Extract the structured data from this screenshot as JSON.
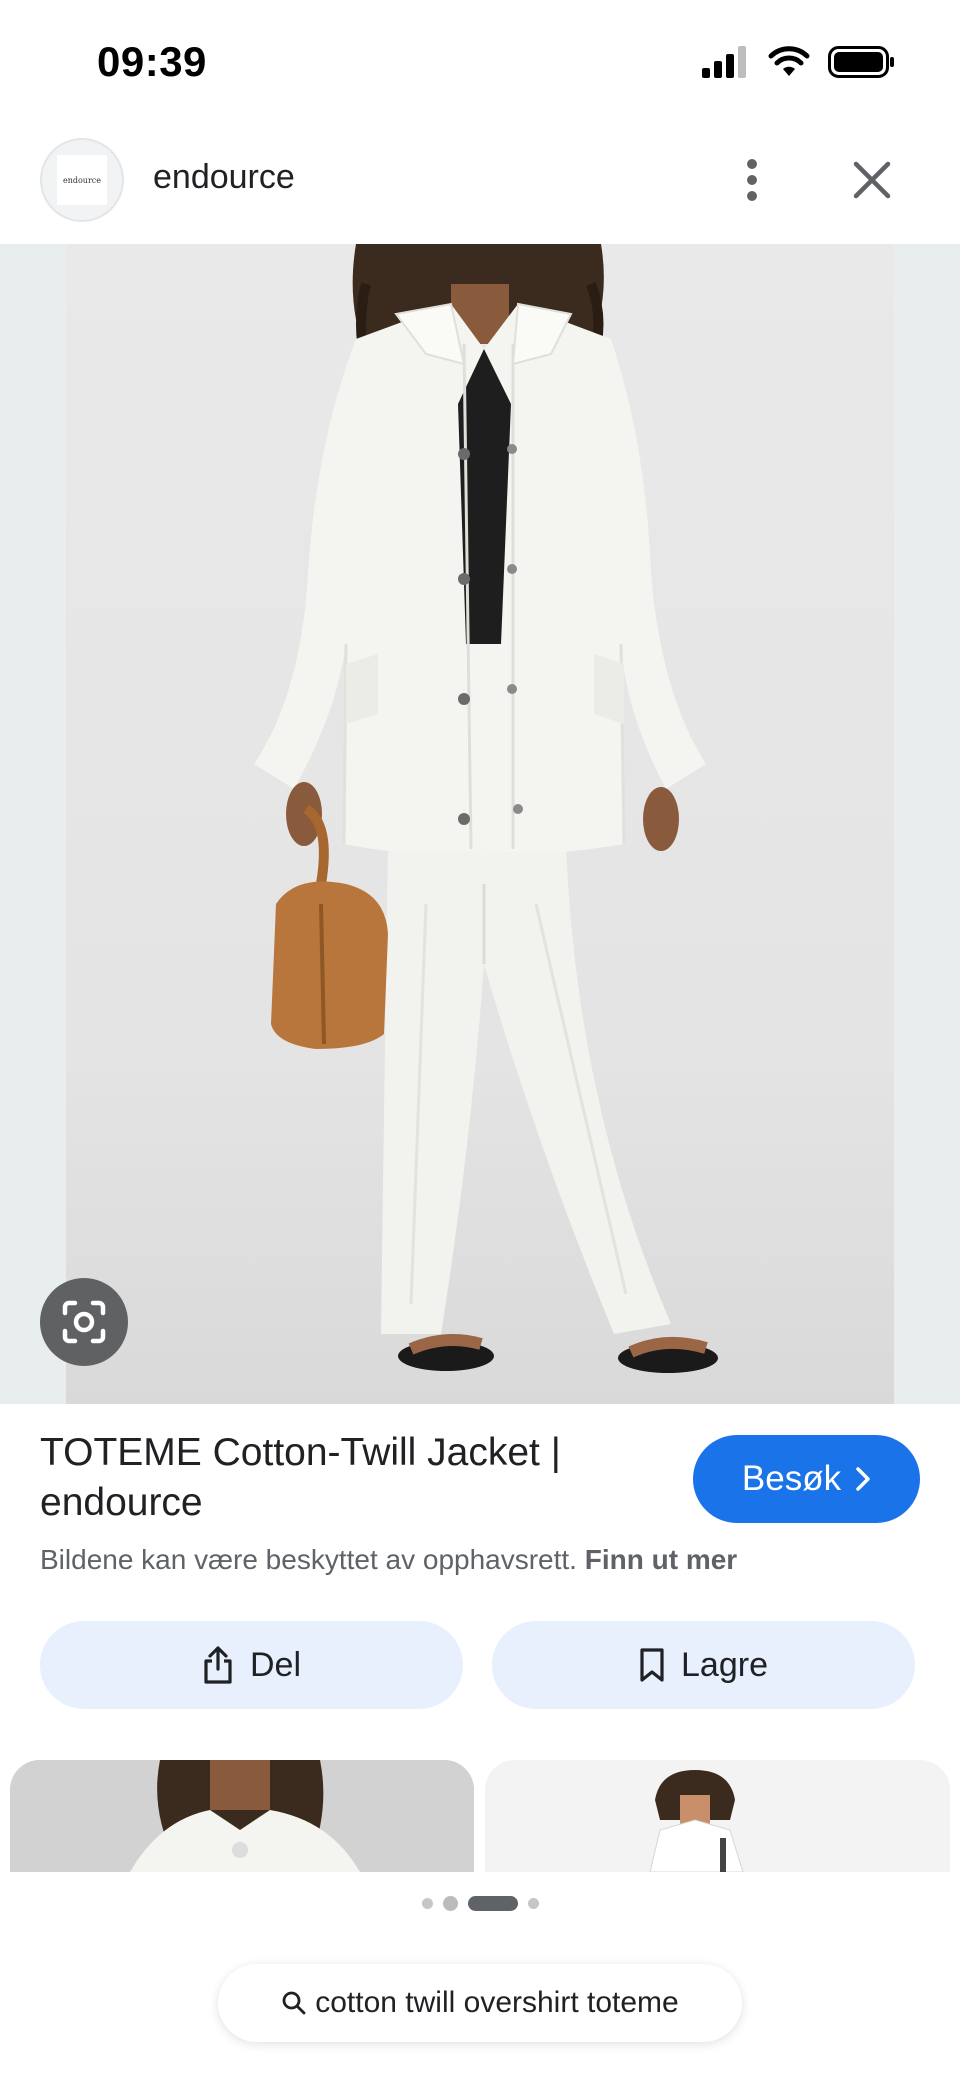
{
  "status_bar": {
    "time": "09:39",
    "icons": [
      "cellular-signal-icon",
      "wifi-icon",
      "battery-icon"
    ]
  },
  "header": {
    "site_logo_text": "endource",
    "site_name": "endource",
    "icons": [
      "more-vertical-icon",
      "close-icon"
    ]
  },
  "image_viewer": {
    "lens_icon": "google-lens-icon"
  },
  "result": {
    "title": "TOTEME Cotton-Twill Jacket | endource",
    "visit_label": "Besøk",
    "copyright_text": "Bildene kan være beskyttet av opphavsrett.",
    "learn_more": "Finn ut mer"
  },
  "actions": {
    "share_label": "Del",
    "save_label": "Lagre"
  },
  "pagination": {
    "dot_count": 4,
    "active_index": 2
  },
  "search": {
    "query": "cotton twill overshirt toteme"
  },
  "colors": {
    "accent": "#1a73e8",
    "action_button_bg": "#e8f0fe",
    "jacket": "#f4f4f0",
    "bag": "#b8763c"
  }
}
